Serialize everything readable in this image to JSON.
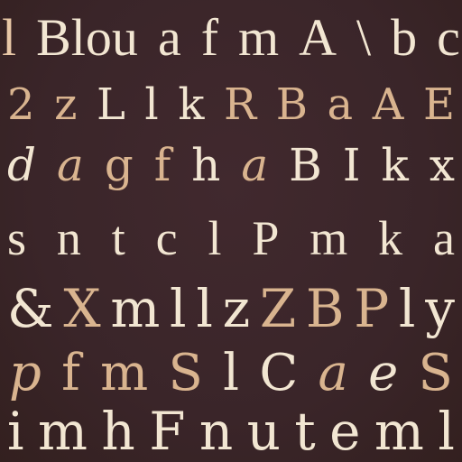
{
  "colors": {
    "background": "#3a2529",
    "cream": "#f2e6d2",
    "tan": "#d9b48f",
    "peach": "#e8c7a6"
  },
  "rows": [
    [
      "l",
      "Blou",
      "a",
      "f",
      "m",
      "A",
      "\\",
      "b",
      "c"
    ],
    [
      "2",
      "z",
      "L",
      "l",
      "k",
      "R",
      "B",
      "a",
      "A",
      "E"
    ],
    [
      "d",
      "a",
      "g",
      "f",
      "h",
      "a",
      "B",
      "I",
      "k",
      "x"
    ],
    [
      "s",
      "n",
      "t",
      "c",
      "l",
      "P",
      "m",
      "k",
      "a"
    ],
    [
      "&",
      "X",
      "m",
      "l",
      "l",
      "z",
      "Z",
      "B",
      "P",
      "l",
      "y"
    ],
    [
      "p",
      "f",
      "m",
      "S",
      "l",
      "C",
      "a",
      "e",
      "S"
    ],
    [
      "i",
      "m",
      "h",
      "F",
      "n",
      "u",
      "t",
      "e",
      "m",
      "l"
    ]
  ]
}
